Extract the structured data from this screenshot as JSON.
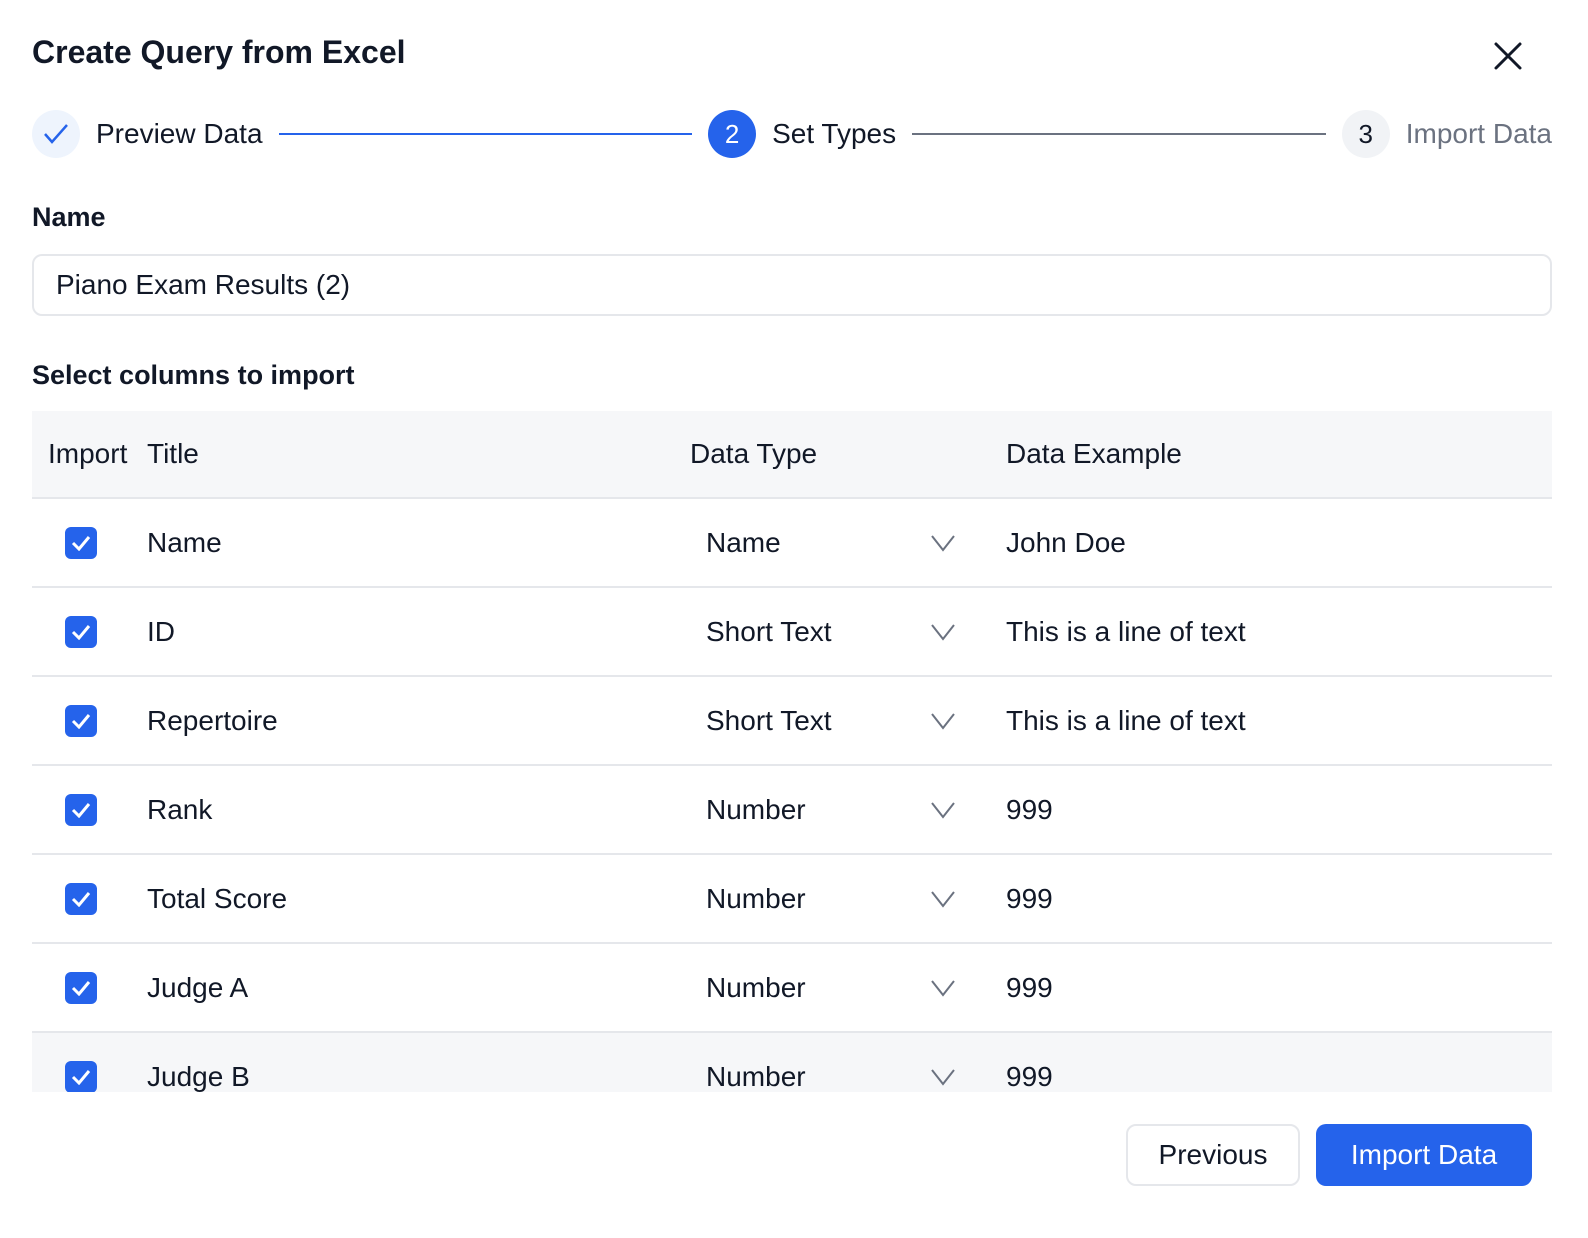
{
  "dialog": {
    "title": "Create Query from Excel",
    "close_icon": "close-icon"
  },
  "stepper": {
    "steps": [
      {
        "label": "Preview Data",
        "marker": "✓",
        "state": "done"
      },
      {
        "label": "Set Types",
        "marker": "2",
        "state": "active"
      },
      {
        "label": "Import Data",
        "marker": "3",
        "state": "todo"
      }
    ]
  },
  "name_field": {
    "label": "Name",
    "value": "Piano Exam Results (2)"
  },
  "columns_section": {
    "label": "Select columns to import"
  },
  "table": {
    "headers": [
      "Import",
      "Title",
      "Data Type",
      "Data Example"
    ],
    "rows": [
      {
        "checked": true,
        "title": "Name",
        "type": "Name",
        "example": "John Doe"
      },
      {
        "checked": true,
        "title": "ID",
        "type": "Short Text",
        "example": "This is a line of text"
      },
      {
        "checked": true,
        "title": "Repertoire",
        "type": "Short Text",
        "example": "This is a line of text"
      },
      {
        "checked": true,
        "title": "Rank",
        "type": "Number",
        "example": "999"
      },
      {
        "checked": true,
        "title": "Total Score",
        "type": "Number",
        "example": "999"
      },
      {
        "checked": true,
        "title": "Judge A",
        "type": "Number",
        "example": "999"
      },
      {
        "checked": true,
        "title": "Judge B",
        "type": "Number",
        "example": "999"
      }
    ]
  },
  "footer": {
    "previous_label": "Previous",
    "import_label": "Import Data"
  },
  "colors": {
    "accent": "#2563eb",
    "line_done": "#2563eb",
    "line_todo": "#6b7280"
  }
}
